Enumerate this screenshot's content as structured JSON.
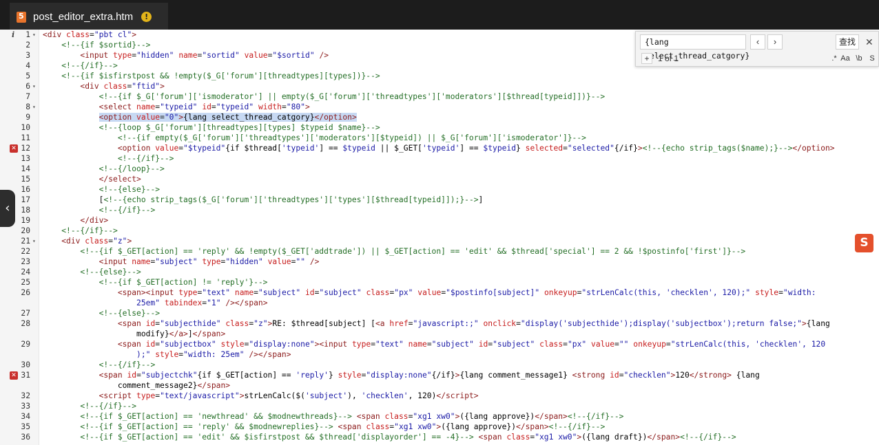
{
  "tab": {
    "title": "post_editor_extra.htm",
    "icon": "html5-icon",
    "warning": "!"
  },
  "find": {
    "query": "{lang select_thread_catgory}",
    "prev": "‹",
    "next": "›",
    "search_label": "查找",
    "close": "✕",
    "expand": "+",
    "count": "1 of 1",
    "opt_regex": ".*",
    "opt_case": "Aa",
    "opt_word": "\\b",
    "opt_sel": "S"
  },
  "gutter": {
    "info": "i"
  },
  "side_handle": "‹",
  "sogou": "S",
  "lines": [
    {
      "n": "1",
      "fold": true,
      "html": "<span class='tag'>&lt;div</span> <span class='attr'>class</span>=<span class='str'>\"pbt cl\"</span><span class='tag'>&gt;</span>"
    },
    {
      "n": "2",
      "html": "    <span class='cmt'>&lt;!--{if $sortid}--&gt;</span>"
    },
    {
      "n": "3",
      "html": "        <span class='tag'>&lt;input</span> <span class='attr'>type</span>=<span class='str'>\"hidden\"</span> <span class='attr'>name</span>=<span class='str'>\"sortid\"</span> <span class='attr'>value</span>=<span class='str'>\"$sortid\"</span> <span class='tag'>/&gt;</span>"
    },
    {
      "n": "4",
      "html": "    <span class='cmt'>&lt;!--{/if}--&gt;</span>"
    },
    {
      "n": "5",
      "html": "    <span class='cmt'>&lt;!--{if $isfirstpost &amp;&amp; !empty($_G['forum'][threadtypes][types])}--&gt;</span>"
    },
    {
      "n": "6",
      "fold": true,
      "html": "        <span class='tag'>&lt;div</span> <span class='attr'>class</span>=<span class='str'>\"ftid\"</span><span class='tag'>&gt;</span>"
    },
    {
      "n": "7",
      "html": "            <span class='cmt'>&lt;!--{if $_G['forum']['ismoderator'] || empty($_G['forum']['threadtypes']['moderators'][$thread[typeid]])}--&gt;</span>"
    },
    {
      "n": "8",
      "fold": true,
      "html": "            <span class='tag'>&lt;select</span> <span class='attr'>name</span>=<span class='str'>\"typeid\"</span> <span class='attr'>id</span>=<span class='str'>\"typeid\"</span> <span class='attr'>width</span>=<span class='str'>\"80\"</span><span class='tag'>&gt;</span>"
    },
    {
      "n": "9",
      "html": "            <span class='hl'><span class='tag'>&lt;option</span> <span class='attr'>value</span>=<span class='str'>\"0\"</span><span class='tag'>&gt;</span><span class='txt'>{lang select_thread_catgory}</span><span class='tag'>&lt;/option&gt;</span></span>"
    },
    {
      "n": "10",
      "html": "            <span class='cmt'>&lt;!--{loop $_G['forum'][threadtypes][types] $typeid $name}--&gt;</span>"
    },
    {
      "n": "11",
      "html": "                <span class='cmt'>&lt;!--{if empty($_G['forum']['threadtypes']['moderators'][$typeid]) || $_G['forum']['ismoderator']}--&gt;</span>"
    },
    {
      "n": "12",
      "err": true,
      "html": "                <span class='tag'>&lt;option</span> <span class='attr'>value</span>=<span class='str'>\"$typeid\"</span><span class='txt'>{if $thread[</span><span class='str'>'typeid'</span><span class='txt'>] == </span><span class='str'>$typeid</span><span class='txt'> || $_GET[</span><span class='str'>'typeid'</span><span class='txt'>] == </span><span class='str'>$typeid</span><span class='txt'>}</span> <span class='attr'>selected</span>=<span class='str'>\"selected\"</span><span class='txt'>{/if}</span><span class='tag'>&gt;</span><span class='cmt'>&lt;!--{echo strip_tags($name);}--&gt;</span><span class='tag'>&lt;/option&gt;</span>"
    },
    {
      "n": "13",
      "html": "                <span class='cmt'>&lt;!--{/if}--&gt;</span>"
    },
    {
      "n": "14",
      "html": "            <span class='cmt'>&lt;!--{/loop}--&gt;</span>"
    },
    {
      "n": "15",
      "html": "            <span class='tag'>&lt;/select&gt;</span>"
    },
    {
      "n": "16",
      "html": "            <span class='cmt'>&lt;!--{else}--&gt;</span>"
    },
    {
      "n": "17",
      "html": "            <span class='txt'>[</span><span class='cmt'>&lt;!--{echo strip_tags($_G['forum']['threadtypes']['types'][$thread[typeid]]);}--&gt;</span><span class='txt'>]</span>"
    },
    {
      "n": "18",
      "html": "            <span class='cmt'>&lt;!--{/if}--&gt;</span>"
    },
    {
      "n": "19",
      "html": "        <span class='tag'>&lt;/div&gt;</span>"
    },
    {
      "n": "20",
      "html": "    <span class='cmt'>&lt;!--{/if}--&gt;</span>"
    },
    {
      "n": "21",
      "fold": true,
      "html": "    <span class='tag'>&lt;div</span> <span class='attr'>class</span>=<span class='str'>\"z\"</span><span class='tag'>&gt;</span>"
    },
    {
      "n": "22",
      "html": "        <span class='cmt'>&lt;!--{if $_GET[action] == 'reply' &amp;&amp; !empty($_GET['addtrade']) || $_GET[action] == 'edit' &amp;&amp; $thread['special'] == 2 &amp;&amp; !$postinfo['first']}--&gt;</span>"
    },
    {
      "n": "23",
      "html": "            <span class='tag'>&lt;input</span> <span class='attr'>name</span>=<span class='str'>\"subject\"</span> <span class='attr'>type</span>=<span class='str'>\"hidden\"</span> <span class='attr'>value</span>=<span class='str'>\"\"</span> <span class='tag'>/&gt;</span>"
    },
    {
      "n": "24",
      "html": "        <span class='cmt'>&lt;!--{else}--&gt;</span>"
    },
    {
      "n": "25",
      "html": "            <span class='cmt'>&lt;!--{if $_GET[action] != 'reply'}--&gt;</span>"
    },
    {
      "n": "26",
      "html": "                <span class='tag'>&lt;span&gt;&lt;input</span> <span class='attr'>type</span>=<span class='str'>\"text\"</span> <span class='attr'>name</span>=<span class='str'>\"subject\"</span> <span class='attr'>id</span>=<span class='str'>\"subject\"</span> <span class='attr'>class</span>=<span class='str'>\"px\"</span> <span class='attr'>value</span>=<span class='str'>\"$postinfo[subject]\"</span> <span class='attr'>onkeyup</span>=<span class='str'>\"strLenCalc(this, 'checklen', 120);\"</span> <span class='attr'>style</span>=<span class='str'>\"width:</span>"
    },
    {
      "n": "",
      "html": "                    <span class='str'>25em\"</span> <span class='attr'>tabindex</span>=<span class='str'>\"1\"</span> <span class='tag'>/&gt;&lt;/span&gt;</span>"
    },
    {
      "n": "27",
      "html": "            <span class='cmt'>&lt;!--{else}--&gt;</span>"
    },
    {
      "n": "28",
      "html": "                <span class='tag'>&lt;span</span> <span class='attr'>id</span>=<span class='str'>\"subjecthide\"</span> <span class='attr'>class</span>=<span class='str'>\"z\"</span><span class='tag'>&gt;</span><span class='txt'>RE: $thread[subject] [</span><span class='tag'>&lt;a</span> <span class='attr'>href</span>=<span class='str'>\"javascript:;\"</span> <span class='attr'>onclick</span>=<span class='str'>\"display('subjecthide');display('subjectbox');return false;\"</span><span class='tag'>&gt;</span><span class='txt'>{lang</span>"
    },
    {
      "n": "",
      "html": "                    <span class='txt'>modify}</span><span class='tag'>&lt;/a&gt;</span><span class='txt'>]</span><span class='tag'>&lt;/span&gt;</span>"
    },
    {
      "n": "29",
      "html": "                <span class='tag'>&lt;span</span> <span class='attr'>id</span>=<span class='str'>\"subjectbox\"</span> <span class='attr'>style</span>=<span class='str'>\"display:none\"</span><span class='tag'>&gt;&lt;input</span> <span class='attr'>type</span>=<span class='str'>\"text\"</span> <span class='attr'>name</span>=<span class='str'>\"subject\"</span> <span class='attr'>id</span>=<span class='str'>\"subject\"</span> <span class='attr'>class</span>=<span class='str'>\"px\"</span> <span class='attr'>value</span>=<span class='str'>\"\"</span> <span class='attr'>onkeyup</span>=<span class='str'>\"strLenCalc(this, 'checklen', 120</span>"
    },
    {
      "n": "",
      "html": "                    <span class='str'>);\"</span> <span class='attr'>style</span>=<span class='str'>\"width: 25em\"</span> <span class='tag'>/&gt;&lt;/span&gt;</span>"
    },
    {
      "n": "30",
      "html": "            <span class='cmt'>&lt;!--{/if}--&gt;</span>"
    },
    {
      "n": "31",
      "err": true,
      "html": "            <span class='tag'>&lt;span</span> <span class='attr'>id</span>=<span class='str'>\"subjectchk\"</span><span class='txt'>{if $_GET[action] == </span><span class='str'>'reply'</span><span class='txt'>}</span> <span class='attr'>style</span>=<span class='str'>\"display:none\"</span><span class='txt'>{/if}</span><span class='tag'>&gt;</span><span class='txt'>{lang comment_message1} </span><span class='tag'>&lt;strong</span> <span class='attr'>id</span>=<span class='str'>\"checklen\"</span><span class='tag'>&gt;</span><span class='txt'>120</span><span class='tag'>&lt;/strong&gt;</span><span class='txt'> {lang</span>"
    },
    {
      "n": "",
      "html": "                <span class='txt'>comment_message2}</span><span class='tag'>&lt;/span&gt;</span>"
    },
    {
      "n": "32",
      "html": "            <span class='tag'>&lt;script</span> <span class='attr'>type</span>=<span class='str'>\"text/javascript\"</span><span class='tag'>&gt;</span><span class='txt'>strLenCalc($(</span><span class='str'>'subject'</span><span class='txt'>), </span><span class='str'>'checklen'</span><span class='txt'>, 120)</span><span class='tag'>&lt;/script&gt;</span>"
    },
    {
      "n": "33",
      "html": "        <span class='cmt'>&lt;!--{/if}--&gt;</span>"
    },
    {
      "n": "34",
      "html": "        <span class='cmt'>&lt;!--{if $_GET[action] == 'newthread' &amp;&amp; $modnewthreads}--&gt;</span> <span class='tag'>&lt;span</span> <span class='attr'>class</span>=<span class='str'>\"xg1 xw0\"</span><span class='tag'>&gt;</span><span class='txt'>({lang approve})</span><span class='tag'>&lt;/span&gt;</span><span class='cmt'>&lt;!--{/if}--&gt;</span>"
    },
    {
      "n": "35",
      "html": "        <span class='cmt'>&lt;!--{if $_GET[action] == 'reply' &amp;&amp; $modnewreplies}--&gt;</span> <span class='tag'>&lt;span</span> <span class='attr'>class</span>=<span class='str'>\"xg1 xw0\"</span><span class='tag'>&gt;</span><span class='txt'>({lang approve})</span><span class='tag'>&lt;/span&gt;</span><span class='cmt'>&lt;!--{/if}--&gt;</span>"
    },
    {
      "n": "36",
      "html": "        <span class='cmt'>&lt;!--{if $_GET[action] == 'edit' &amp;&amp; $isfirstpost &amp;&amp; $thread['displayorder'] == -4}--&gt;</span> <span class='tag'>&lt;span</span> <span class='attr'>class</span>=<span class='str'>\"xg1 xw0\"</span><span class='tag'>&gt;</span><span class='txt'>({lang draft})</span><span class='tag'>&lt;/span&gt;</span><span class='cmt'>&lt;!--{/if}--&gt;</span>"
    }
  ]
}
